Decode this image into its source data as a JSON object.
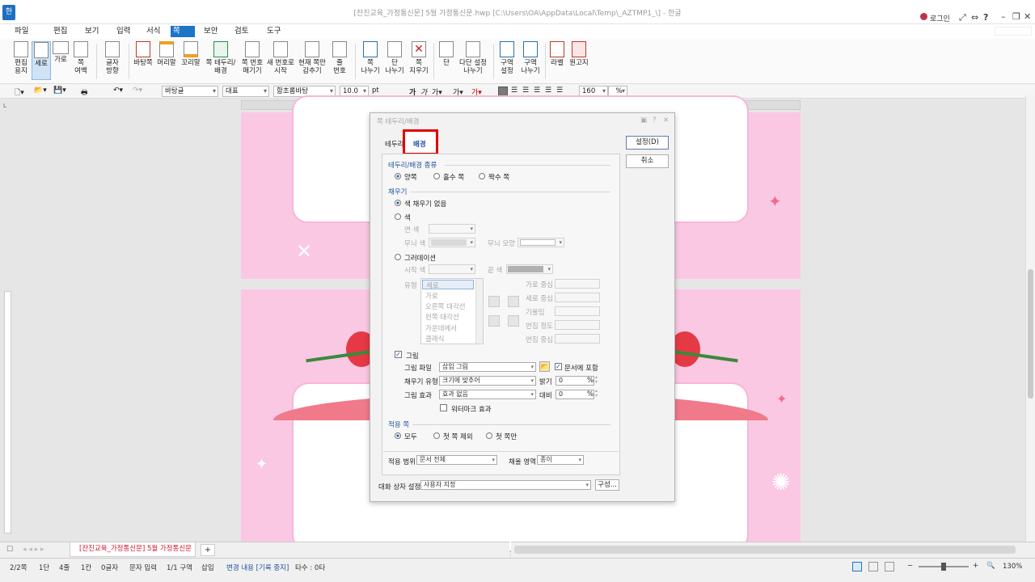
{
  "titlebar": {
    "title": "[잔진교육_가정통신문] 5월 가정통신문.hwp [C:\\Users\\OA\\AppData\\Local\\Temp\\_AZTMP1_\\] - 한글",
    "login": "로그인",
    "help": "?"
  },
  "menu": [
    {
      "label": "파일"
    },
    {
      "label": "편집"
    },
    {
      "label": "보기"
    },
    {
      "label": "입력"
    },
    {
      "label": "서식"
    },
    {
      "label": "쪽"
    },
    {
      "label": "보안"
    },
    {
      "label": "검토"
    },
    {
      "label": "도구"
    }
  ],
  "ribbon": [
    {
      "label": "편집\n용지"
    },
    {
      "label": "세로"
    },
    {
      "label": "가로"
    },
    {
      "label": "쪽\n여백"
    },
    {
      "label": "글자\n방향"
    },
    {
      "label": "바탕쪽"
    },
    {
      "label": "머리말"
    },
    {
      "label": "꼬리말"
    },
    {
      "label": "쪽 테두리/\n배경"
    },
    {
      "label": "쪽 번호\n매기기"
    },
    {
      "label": "새 번호로\n시작"
    },
    {
      "label": "현재 쪽만\n감추기"
    },
    {
      "label": "줄\n번호"
    },
    {
      "label": "쪽\n나누기"
    },
    {
      "label": "단\n나누기"
    },
    {
      "label": "쪽\n지우기"
    },
    {
      "label": "단"
    },
    {
      "label": "다단 설정\n나누기"
    },
    {
      "label": "구역\n설정"
    },
    {
      "label": "구역\n나누기"
    },
    {
      "label": "라벨"
    },
    {
      "label": "원고지"
    }
  ],
  "format": {
    "style": "바탕글",
    "sub": "대표",
    "font": "함초롬바탕",
    "size": "10.0",
    "unit": "pt",
    "zoom": "160",
    "zoom_unit": "%"
  },
  "dialog": {
    "title": "쪽 테두리/배경",
    "tabs": [
      {
        "label": "테두리"
      },
      {
        "label": "배경"
      }
    ],
    "ok": "설정(D)",
    "cancel": "취소",
    "type_group": "테두리/배경 종류",
    "type_options": [
      {
        "label": "양쪽"
      },
      {
        "label": "홀수 쪽"
      },
      {
        "label": "짝수 쪽"
      }
    ],
    "fill_group": "채우기",
    "no_fill": "색 채우기 없음",
    "color": "색",
    "face_color": "면 색",
    "pattern_color": "무늬 색",
    "pattern_shape": "무늬 모양",
    "gradation": "그러데이션",
    "start_color": "시작 색",
    "end_color": "끝 색",
    "type_label": "유형",
    "grad_types": [
      "세로",
      "가로",
      "오른쪽 대각선",
      "왼쪽 대각선",
      "가운데에서",
      "클래식"
    ],
    "grad_fields": [
      "가로 중심",
      "세로 중심",
      "기울임",
      "번짐 정도",
      "번짐 중심"
    ],
    "picture": "그림",
    "pic_file": "그림 파일",
    "pic_file_value": "삽입 그림",
    "include_doc": "문서에 포함",
    "fill_type": "채우기 유형",
    "fill_type_value": "크기에 맞추어",
    "brightness": "밝기",
    "brightness_value": "0",
    "pic_effect": "그림 효과",
    "pic_effect_value": "효과 없음",
    "contrast": "대비",
    "contrast_value": "0",
    "percent": "%",
    "watermark": "워터마크 효과",
    "apply_group": "적용 쪽",
    "apply_options": [
      {
        "label": "모두"
      },
      {
        "label": "첫 쪽 제외"
      },
      {
        "label": "첫 쪽만"
      }
    ],
    "apply_range": "적용 범위",
    "apply_range_value": "문서 전체",
    "base": "채울 영역",
    "base_value": "종이",
    "dialog_setting": "대화 상자 설정",
    "dialog_setting_value": "사용자 지정",
    "config": "구성..."
  },
  "tab": {
    "label": "[잔진교육_가정통신문] 5월 가정통신문",
    "add": "+"
  },
  "status": [
    {
      "label": "2/2쪽"
    },
    {
      "label": "1단"
    },
    {
      "label": "4줄"
    },
    {
      "label": "1칸"
    },
    {
      "label": "0글자"
    },
    {
      "label": "문자 입력"
    },
    {
      "label": "1/1 구역"
    },
    {
      "label": "삽입"
    },
    {
      "label": "변경 내용 [기록 중지]"
    },
    {
      "label": "타수 : 0타"
    }
  ],
  "zoom_status": "130%",
  "colors": {
    "accent": "#1c75c7",
    "page_pink": "#fbc8e4",
    "highlight_red": "#e30000",
    "ribbon_pink": "#f07a8a"
  }
}
